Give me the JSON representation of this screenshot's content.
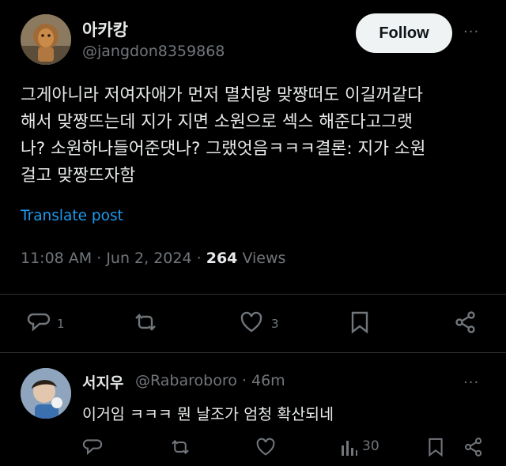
{
  "tweet": {
    "author_name": "아카캉",
    "author_handle": "@jangdon8359868",
    "follow_label": "Follow",
    "more_glyph": "···",
    "text": "그게아니라 저여자애가 먼저 멸치랑 맞짱떠도 이길꺼같다\n해서 맞짱뜨는데 지가 지면 소원으로 섹스 해준다고그랫\n나? 소원하나들어준댓나? 그랬엇음ㅋㅋㅋ결론: 지가 소원\n걸고 맞짱뜨자함",
    "translate_label": "Translate post",
    "time": "11:08 AM",
    "date": "Jun 2, 2024",
    "views_count": "264",
    "views_label": "Views",
    "sep": "·",
    "actions": {
      "reply_count": "1",
      "retweet_count": "",
      "like_count": "3",
      "icons": [
        "reply-icon",
        "retweet-icon",
        "like-icon",
        "bookmark-icon",
        "share-icon"
      ]
    }
  },
  "reply": {
    "author_name": "서지우",
    "author_handle": "@Rabaroboro",
    "time": "46m",
    "sep": "·",
    "more_glyph": "···",
    "text": "이거임 ㅋㅋㅋ 뭔 날조가 엄청 확산되네",
    "actions": {
      "views_count": "30",
      "icons": [
        "reply-icon",
        "retweet-icon",
        "like-icon",
        "views-icon",
        "bookmark-icon",
        "share-icon"
      ]
    }
  },
  "colors": {
    "background": "#000000",
    "text": "#e7e9ea",
    "secondary": "#71767b",
    "link": "#1d9bf0",
    "divider": "#2f3336"
  }
}
